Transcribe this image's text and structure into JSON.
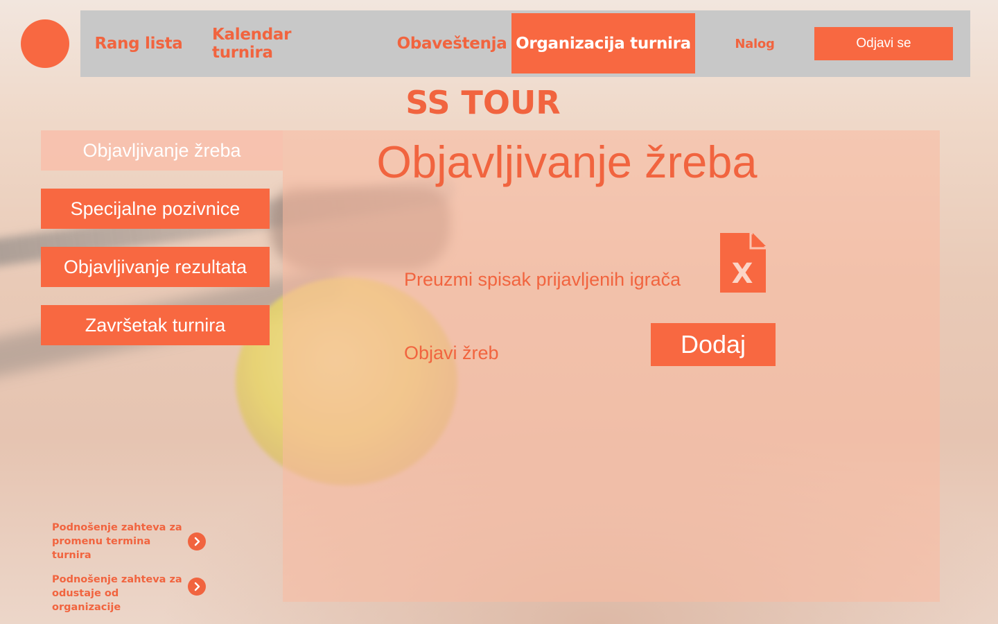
{
  "colors": {
    "accent": "#f86841",
    "nav_bg": "#c8c8c8"
  },
  "nav": {
    "items": [
      {
        "label": "Rang lista"
      },
      {
        "label": "Kalendar turnira"
      },
      {
        "label": "Obaveštenja"
      },
      {
        "label": "Organizacija turnira",
        "active": true
      },
      {
        "label": "Nalog"
      }
    ],
    "logout_label": "Odjavi se"
  },
  "brand": "SS TOUR",
  "sidebar": {
    "items": [
      {
        "label": "Objavljivanje žreba",
        "active": true
      },
      {
        "label": "Specijalne pozivnice"
      },
      {
        "label": "Objavljivanje rezultata"
      },
      {
        "label": "Završetak turnira"
      }
    ],
    "requests": [
      {
        "label": "Podnošenje zahteva za promenu termina turnira"
      },
      {
        "label": "Podnošenje zahteva za odustaje od organizacije"
      }
    ]
  },
  "main": {
    "title": "Objavljivanje žreba",
    "download_label": "Preuzmi spisak prijavljenih igrača",
    "download_icon": "excel-file-icon",
    "publish_label": "Objavi žreb",
    "add_button": "Dodaj"
  }
}
